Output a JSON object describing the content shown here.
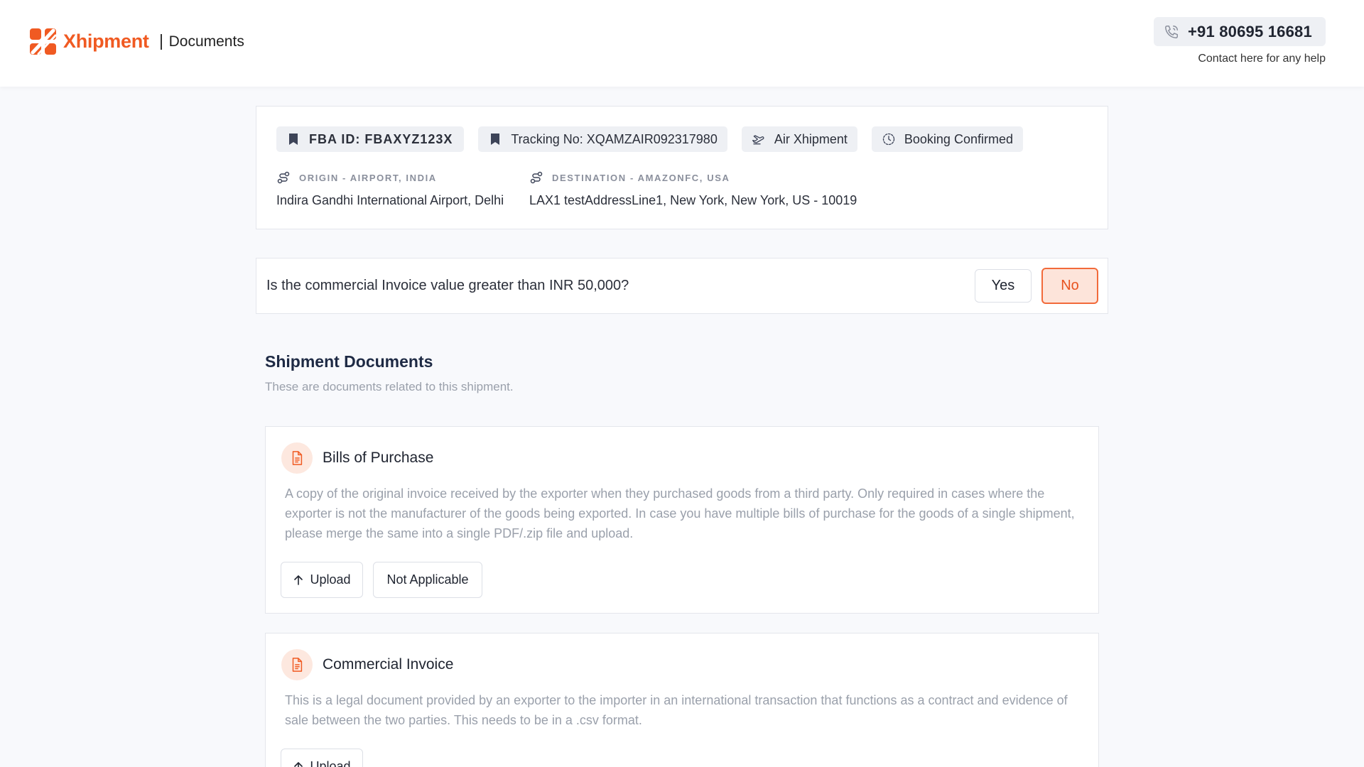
{
  "header": {
    "brand_name": "Xhipment",
    "page_name": "Documents",
    "brand_color": "#f05a22",
    "help": {
      "phone": "+91 80695 16681",
      "note": "Contact here for any help",
      "icon": "phone-icon"
    }
  },
  "shipment": {
    "chips": {
      "fba_id": "FBA ID: FBAXYZ123X",
      "tracking": "Tracking No: XQAMZAIR092317980",
      "mode": "Air Xhipment",
      "status": "Booking Confirmed"
    },
    "origin": {
      "label": "ORIGIN - AIRPORT, INDIA",
      "value": "Indira Gandhi International Airport, Delhi"
    },
    "destination": {
      "label": "DESTINATION - AMAZONFC, USA",
      "value": "LAX1 testAddressLine1, New York, New York, US - 10019"
    }
  },
  "invoice_question": {
    "text": "Is the commercial Invoice value greater than INR 50,000?",
    "yes_label": "Yes",
    "no_label": "No",
    "selected": "No"
  },
  "documents_section": {
    "title": "Shipment Documents",
    "subtitle": "These are documents related to this shipment.",
    "items": [
      {
        "title": "Bills of Purchase",
        "description": "A copy of the original invoice received by the exporter when they purchased goods from a third party. Only required in cases where the exporter is not the manufacturer of the goods being exported. In case you have multiple bills of purchase for the goods of a single shipment, please merge the same into a single PDF/.zip file and upload.",
        "upload_label": "Upload",
        "na_label": "Not Applicable"
      },
      {
        "title": "Commercial Invoice",
        "description": "This is a legal document provided by an exporter to the importer in an international transaction that functions as a contract and evidence of sale between the two parties. This needs to be in a .csv format.",
        "upload_label": "Upload"
      }
    ]
  },
  "colors": {
    "accent": "#f05a22",
    "selected_bg": "#fde4da",
    "chip_bg": "#eef0f4",
    "muted_text": "#9aa0ab"
  }
}
